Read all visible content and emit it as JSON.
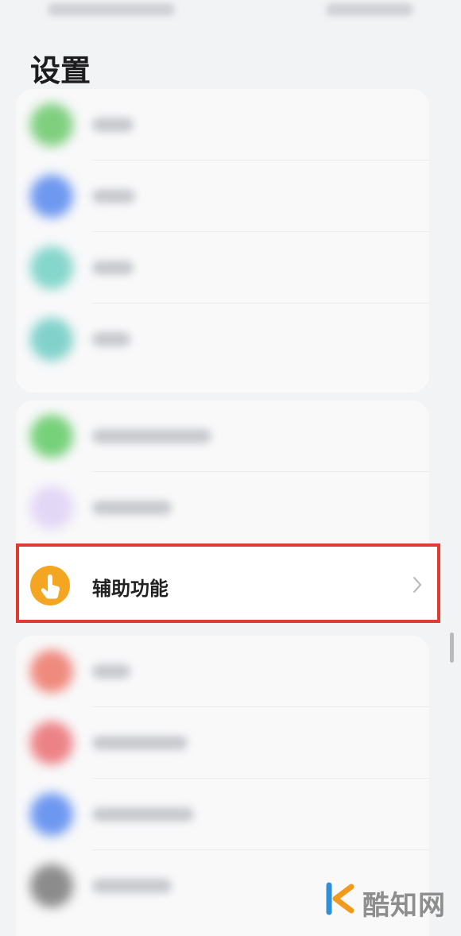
{
  "header": {
    "title": "设置"
  },
  "accessibility_item": {
    "label": "辅助功能",
    "icon": "hand-pointer-icon",
    "chevron": "chevron-right-icon"
  },
  "colors": {
    "accessibility_icon_bg": "#f4a521",
    "highlight_border": "#e03a33"
  },
  "watermark": {
    "text": "酷知网",
    "logo": "kz-logo"
  }
}
